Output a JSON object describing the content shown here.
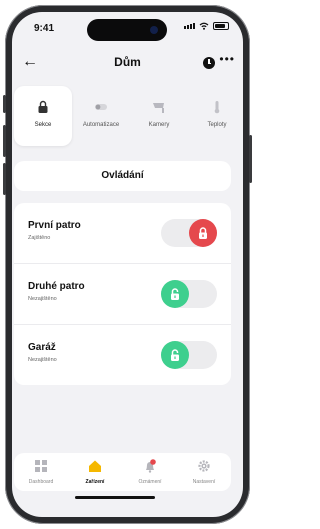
{
  "status": {
    "time": "9:41"
  },
  "header": {
    "title": "Dům"
  },
  "tabs": [
    {
      "label": "Sekce",
      "icon": "lock-icon",
      "active": true
    },
    {
      "label": "Automatizace",
      "icon": "toggle-icon",
      "active": false
    },
    {
      "label": "Kamery",
      "icon": "camera-icon",
      "active": false
    },
    {
      "label": "Teploty",
      "icon": "thermometer-icon",
      "active": false
    }
  ],
  "control": {
    "label": "Ovládání"
  },
  "zones": [
    {
      "name": "První patro",
      "status": "Zajištěno",
      "locked": true
    },
    {
      "name": "Druhé patro",
      "status": "Nezajištěno",
      "locked": false
    },
    {
      "name": "Garáž",
      "status": "Nezajištěno",
      "locked": false
    }
  ],
  "nav": [
    {
      "label": "Dashboard",
      "icon": "dashboard-icon",
      "active": false
    },
    {
      "label": "Zařízení",
      "icon": "home-icon",
      "active": true
    },
    {
      "label": "Oznámení",
      "icon": "bell-icon",
      "active": false,
      "badge": true
    },
    {
      "label": "Nastavení",
      "icon": "gear-icon",
      "active": false
    }
  ],
  "colors": {
    "locked": "#e5484d",
    "unlocked": "#3ecf8e",
    "accent": "#f5b800"
  }
}
